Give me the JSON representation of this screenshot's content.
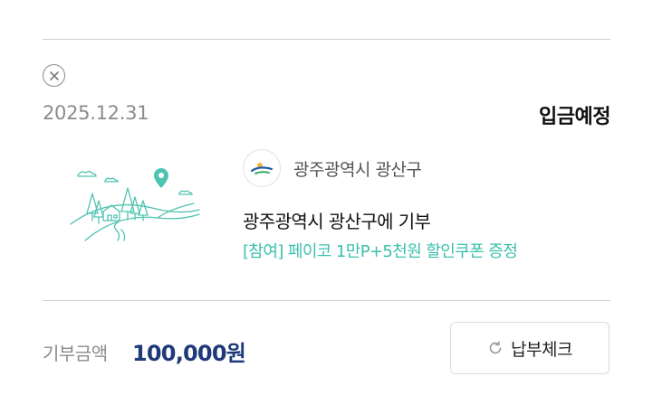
{
  "record": {
    "date": "2025.12.31",
    "status": "입금예정",
    "organization": "광주광역시 광산구",
    "title": "광주광역시 광산구에 기부",
    "promotion": "[참여] 페이코 1만P+5천원 할인쿠폰 증정"
  },
  "amount": {
    "label": "기부금액",
    "value": "100,000원"
  },
  "actions": {
    "check_label": "납부체크"
  },
  "icons": {
    "close": "close-circle-icon",
    "refresh": "refresh-icon",
    "org_logo": "gwangsan-logo"
  },
  "colors": {
    "promo": "#3bbfad",
    "amount": "#1f3a7a",
    "illustration": "#4fc3b0"
  }
}
